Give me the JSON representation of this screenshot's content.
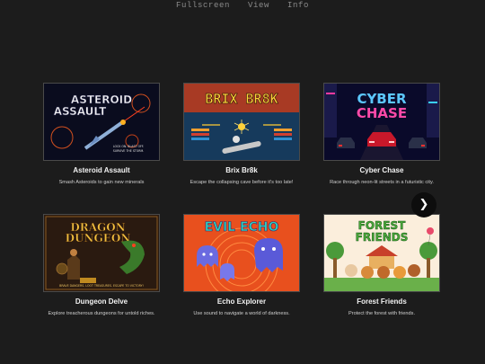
{
  "menu": [
    "Fullscreen",
    "View",
    "Info"
  ],
  "games": [
    {
      "title": "Asteroid Assault",
      "description": "Smash Asteroids to gain new minerals",
      "thumb_title": [
        "ASTEROID",
        "ASSAULT"
      ],
      "thumb_caption": [
        "LOCK ON. BLAST OFF.",
        "SURVIVE THE STORM."
      ]
    },
    {
      "title": "Brix Br8k",
      "description": "Escape the collapsing cave before it's too late!",
      "thumb_title": "BRIX BR8K"
    },
    {
      "title": "Cyber Chase",
      "description": "Race through neon-lit streets in a futuristic city.",
      "thumb_title": [
        "CYBER",
        "CHASE"
      ]
    },
    {
      "title": "Dungeon Delve",
      "description": "Explore treacherous dungeons for untold riches.",
      "thumb_title": [
        "DRAGON",
        "DUNGEON"
      ],
      "thumb_caption": "BRAVE DANGERS. LOOT TREASURES. ESCAPE TO VICTORY!"
    },
    {
      "title": "Echo Explorer",
      "description": "Use sound to navigate a world of darkness.",
      "thumb_title": "EVIL ECHO"
    },
    {
      "title": "Forest Friends",
      "description": "Protect the forest with friends.",
      "thumb_title": [
        "FOREST",
        "FRIENDS"
      ]
    }
  ],
  "carousel": {
    "next_icon": "❯"
  },
  "colors": {
    "background": "#1c1c1c",
    "menu_text": "#8a8a8a",
    "card_title": "#f2f2f2",
    "card_desc": "#cfcfcf"
  }
}
